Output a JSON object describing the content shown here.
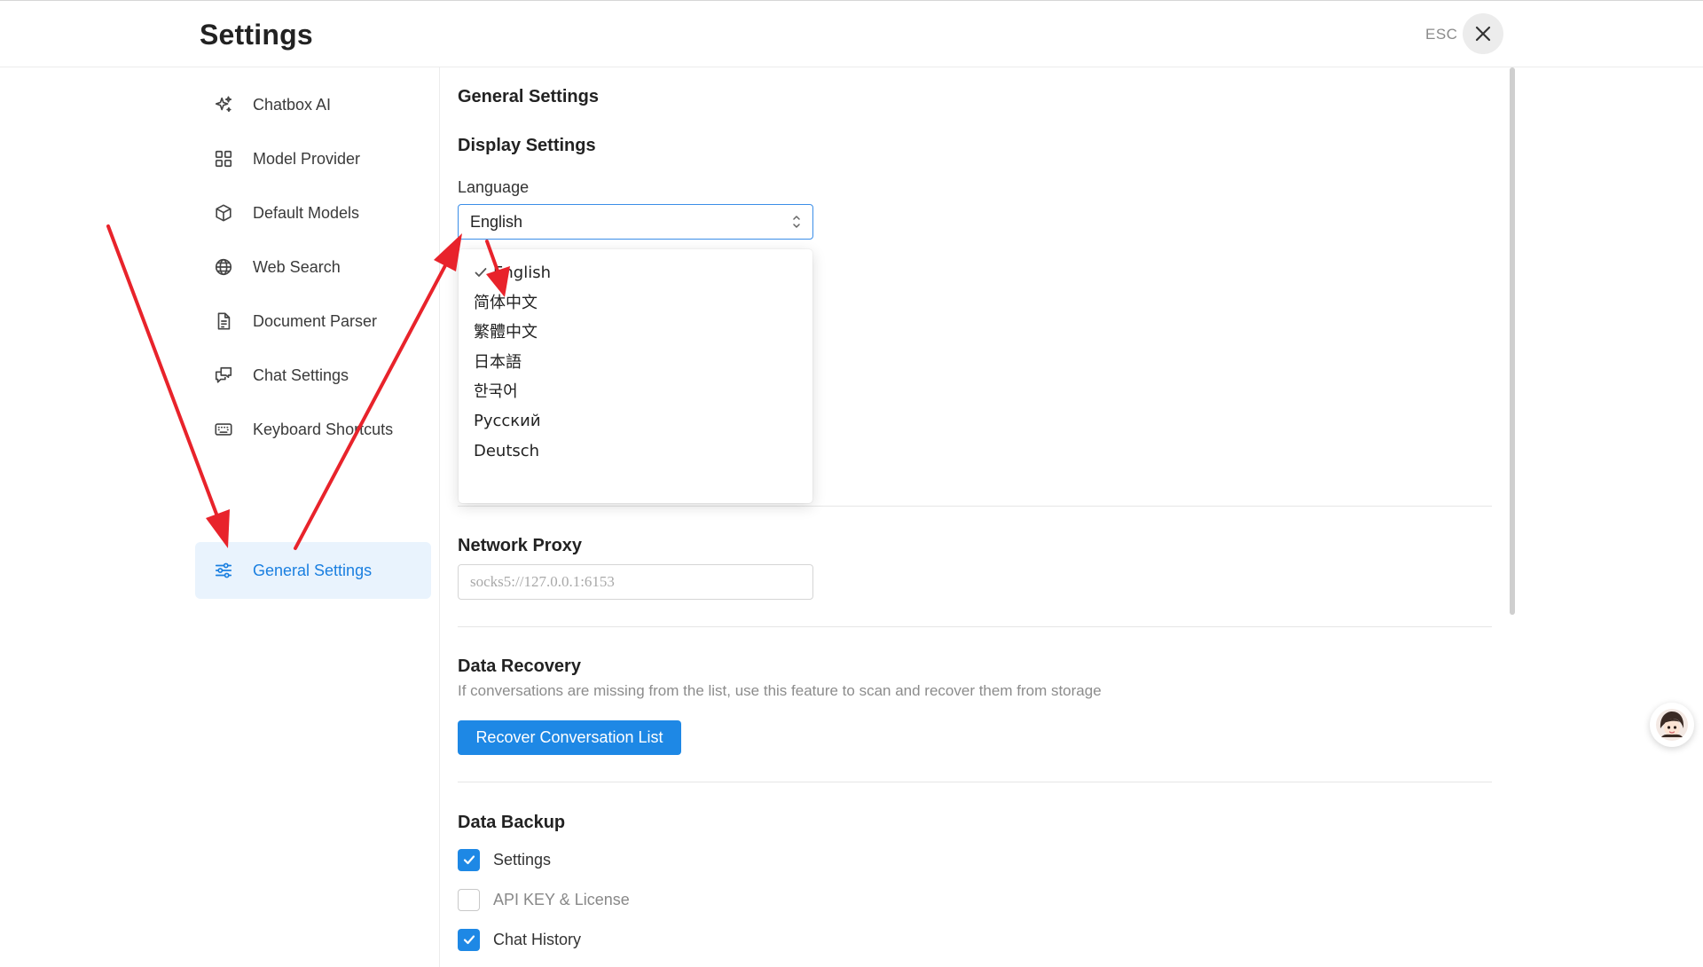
{
  "header": {
    "title": "Settings",
    "esc_label": "ESC"
  },
  "sidebar": {
    "items": [
      {
        "label": "Chatbox AI",
        "icon": "sparkles-icon"
      },
      {
        "label": "Model Provider",
        "icon": "grid-icon"
      },
      {
        "label": "Default Models",
        "icon": "cube-icon"
      },
      {
        "label": "Web Search",
        "icon": "globe-icon"
      },
      {
        "label": "Document Parser",
        "icon": "document-icon"
      },
      {
        "label": "Chat Settings",
        "icon": "chat-bubbles-icon"
      },
      {
        "label": "Keyboard Shortcuts",
        "icon": "keyboard-icon"
      },
      {
        "label": "General Settings",
        "icon": "sliders-icon",
        "active": true
      }
    ]
  },
  "main": {
    "heading": "General Settings",
    "display": {
      "heading": "Display Settings",
      "language_label": "Language",
      "language_value": "English",
      "language_options": [
        "English",
        "简体中文",
        "繁體中文",
        "日本語",
        "한국어",
        "Русский",
        "Deutsch"
      ]
    },
    "proxy": {
      "heading": "Network Proxy",
      "placeholder": "socks5://127.0.0.1:6153"
    },
    "recovery": {
      "heading": "Data Recovery",
      "description": "If conversations are missing from the list, use this feature to scan and recover them from storage",
      "button_label": "Recover Conversation List"
    },
    "backup": {
      "heading": "Data Backup",
      "options": [
        {
          "label": "Settings",
          "checked": true
        },
        {
          "label": "API KEY & License",
          "checked": false
        },
        {
          "label": "Chat History",
          "checked": true
        }
      ]
    }
  },
  "colors": {
    "accent": "#1e88e5",
    "active_bg": "#e9f3fd",
    "annotation_arrow": "#e8232b"
  }
}
